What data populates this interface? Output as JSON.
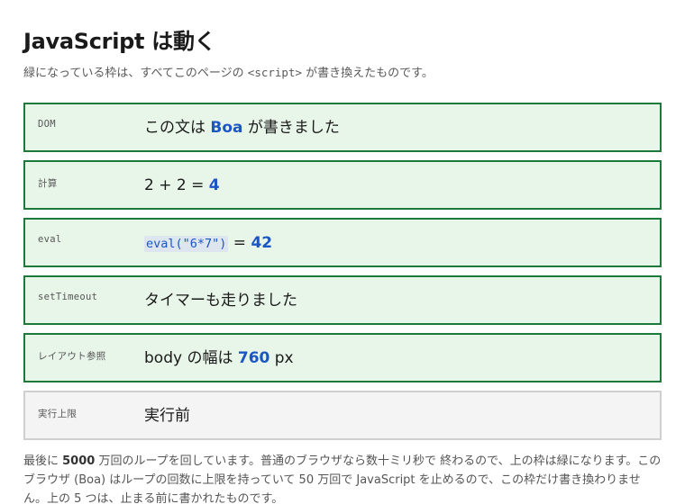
{
  "header": {
    "title": "JavaScript は動く",
    "subtitle_before": "緑になっている枠は、すべてこのページの ",
    "subtitle_code": "<script>",
    "subtitle_after": " が書き換えたものです。"
  },
  "rows": [
    {
      "label": "DOM",
      "status": "green",
      "before": "この文は ",
      "highlight": "Boa",
      "after": " が書きました"
    },
    {
      "label": "計算",
      "status": "green",
      "before": "2 + 2 = ",
      "highlight": "4"
    },
    {
      "label": "eval",
      "status": "green",
      "code": "eval(\"6*7\")",
      "middle": " = ",
      "highlight": "42"
    },
    {
      "label": "setTimeout",
      "status": "green",
      "text": "タイマーも走りました"
    },
    {
      "label": "レイアウト参照",
      "status": "green",
      "before": "body の幅は ",
      "highlight": "760",
      "after": " px"
    },
    {
      "label": "実行上限",
      "status": "pending",
      "text": "実行前"
    }
  ],
  "footer": {
    "p1": "最後に ",
    "p1_bold": "5000",
    "p2": " 万回のループを回しています。普通のブラウザなら数十ミリ秒で 終わるので、上の枠は緑になります。このブラウザ (Boa) はループの回数に上限を持っていて 50 万回で JavaScript を止めるので、この枠だけ書き換わりません。上の 5 つは、止まる前に書かれたものです。"
  }
}
